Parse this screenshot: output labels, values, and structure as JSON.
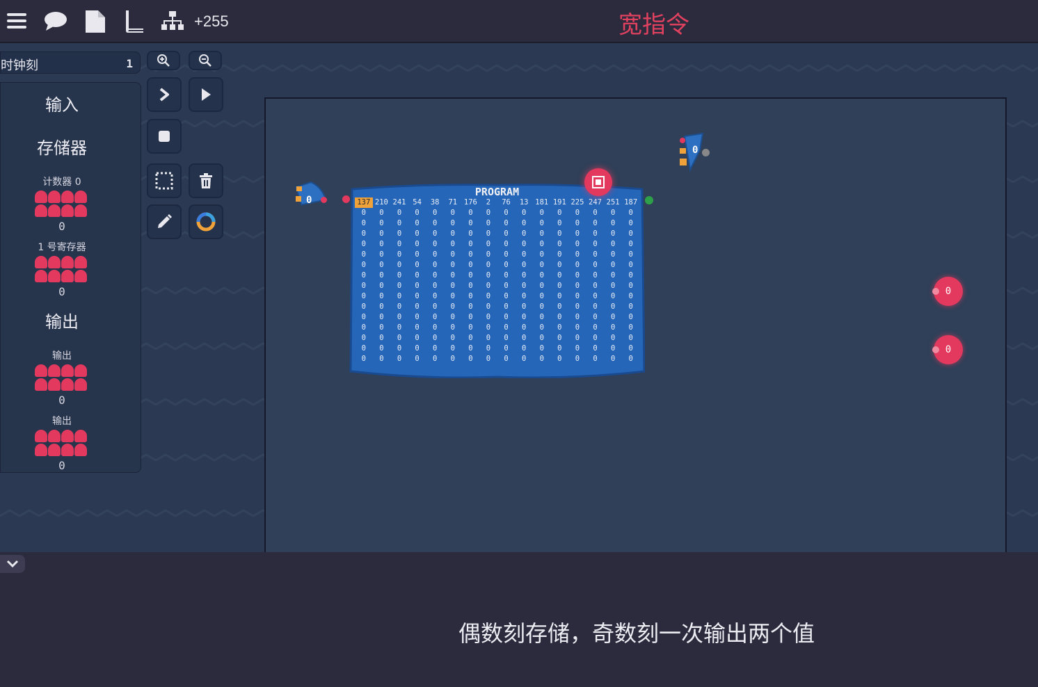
{
  "toolbar": {
    "icons": [
      "menu-icon",
      "chat-icon",
      "document-icon",
      "book-icon",
      "hierarchy-icon"
    ],
    "count": "+255",
    "level_title": "宽指令",
    "title_color": "#e0415f"
  },
  "clock": {
    "label": "时钟刻",
    "value": "1"
  },
  "panel": {
    "input_heading": "输入",
    "memory_heading": "存储器",
    "counter": {
      "label": "计数器 0",
      "value": "0"
    },
    "register1": {
      "label": "1 号寄存器",
      "value": "0"
    },
    "output_heading": "输出",
    "outputs": [
      {
        "label": "输出",
        "value": "0"
      },
      {
        "label": "输出",
        "value": "0"
      }
    ],
    "bit_color": "#e4395e"
  },
  "controls": [
    "zoom-in",
    "zoom-out",
    "step",
    "play",
    "stop",
    "select",
    "delete",
    "edit",
    "color-wheel"
  ],
  "program": {
    "title": "PROGRAM",
    "header": [
      "137",
      "210",
      "241",
      "54",
      "38",
      "71",
      "176",
      "2",
      "76",
      "13",
      "181",
      "191",
      "225",
      "247",
      "251",
      "187"
    ],
    "active_index": 0,
    "zero_rows": 15,
    "zero_value": "0"
  },
  "components": {
    "input_left_value": "0",
    "input_top_value": "0",
    "output_node_1": "0",
    "output_node_2": "0"
  },
  "description": "偶数刻存储，奇数刻一次输出两个值"
}
